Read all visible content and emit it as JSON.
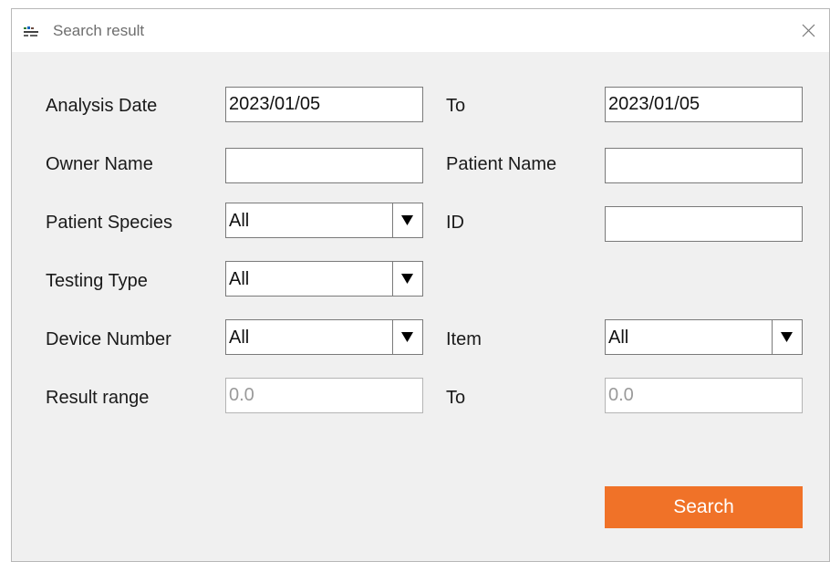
{
  "window": {
    "title": "Search result",
    "app_icon": "app-logo-icon",
    "close_icon": "close-icon"
  },
  "form": {
    "analysis_date_label": "Analysis Date",
    "analysis_date_from": "2023/01/05",
    "analysis_date_to_label": "To",
    "analysis_date_to": "2023/01/05",
    "owner_name_label": "Owner Name",
    "owner_name_value": "",
    "patient_name_label": "Patient Name",
    "patient_name_value": "",
    "patient_species_label": "Patient Species",
    "patient_species_value": "All",
    "id_label": "ID",
    "id_value": "",
    "testing_type_label": "Testing Type",
    "testing_type_value": "All",
    "device_number_label": "Device Number",
    "device_number_value": "All",
    "item_label": "Item",
    "item_value": "All",
    "result_range_label": "Result range",
    "result_range_from_placeholder": "0.0",
    "result_range_to_label": "To",
    "result_range_to_placeholder": "0.0"
  },
  "actions": {
    "search_label": "Search"
  },
  "colors": {
    "accent": "#f07228",
    "window_bg": "#f0f0f0"
  }
}
